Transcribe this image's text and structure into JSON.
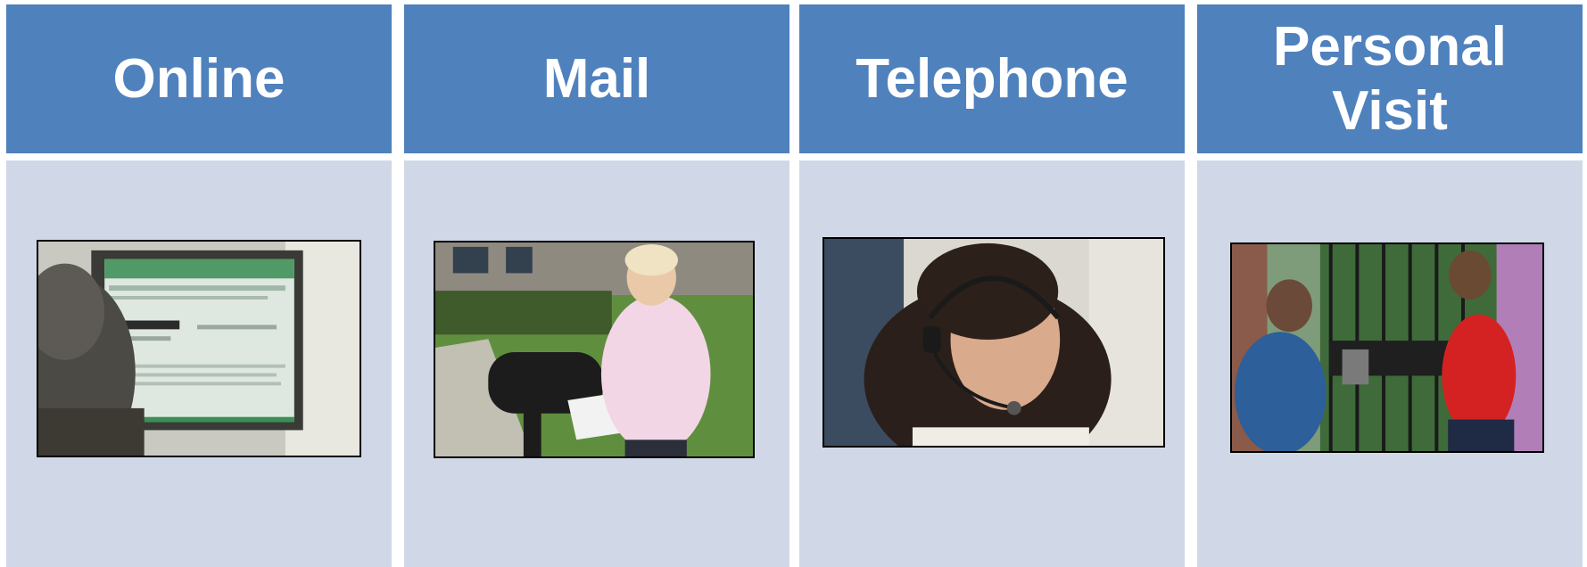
{
  "channels": [
    {
      "label": "Online",
      "photo": "person-viewing-online-survey-form"
    },
    {
      "label": "Mail",
      "photo": "woman-placing-letter-in-mailbox"
    },
    {
      "label": "Telephone",
      "photo": "woman-wearing-headset"
    },
    {
      "label": "Personal\nVisit",
      "photo": "interviewer-with-tablet-visiting-resident"
    }
  ],
  "colors": {
    "header_bg": "#4f81bd",
    "panel_bg": "#d0d8e8",
    "header_text": "#ffffff"
  }
}
